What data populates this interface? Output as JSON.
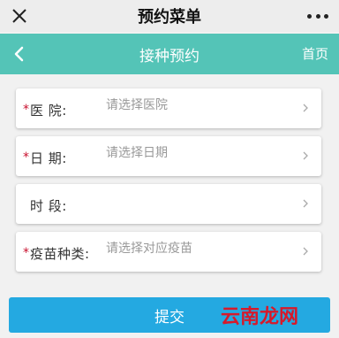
{
  "titlebar": {
    "title": "预约菜单"
  },
  "navbar": {
    "title": "接种预约",
    "home_label": "首页"
  },
  "form": {
    "rows": [
      {
        "required": "*",
        "label": "医  院:",
        "value": "请选择医院"
      },
      {
        "required": "*",
        "label": "日  期:",
        "value": "请选择日期"
      },
      {
        "required": "",
        "label": "时  段:",
        "value": ""
      },
      {
        "required": "*",
        "label": "疫苗种类:",
        "value": "请选择对应疫苗"
      }
    ]
  },
  "submit_label": "提交",
  "watermark": "云南龙网",
  "colors": {
    "nav_bg": "#54c4b7",
    "submit_bg": "#24a9e1",
    "required": "#c8102e",
    "watermark": "#d7192a"
  }
}
